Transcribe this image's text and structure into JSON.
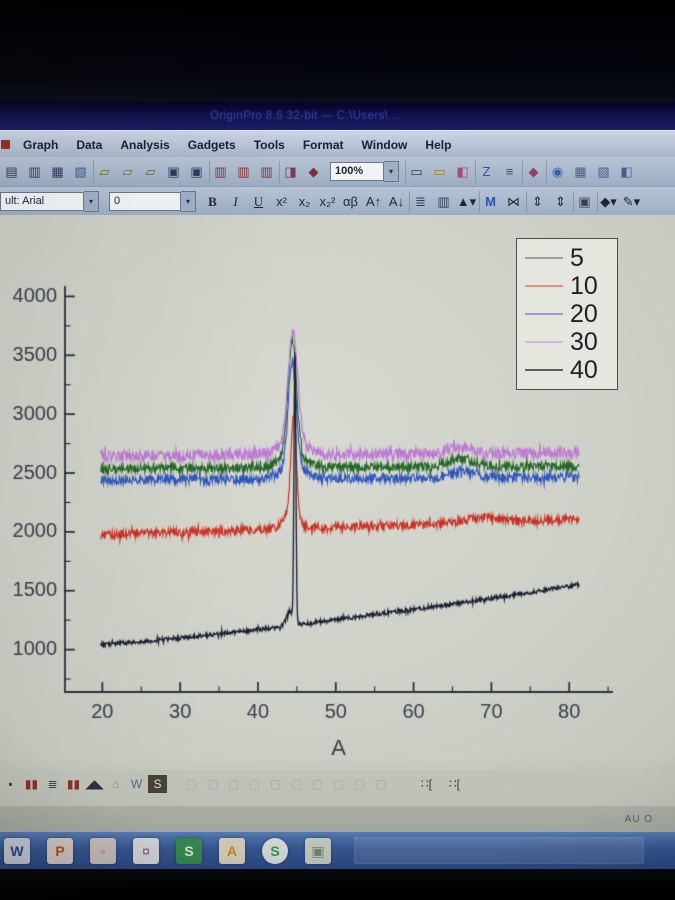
{
  "window": {
    "title": "OriginPro 8.6 32-bit — C:\\Users\\..."
  },
  "menu": {
    "items": [
      {
        "label": "Graph",
        "name": "graph"
      },
      {
        "label": "Data",
        "name": "data"
      },
      {
        "label": "Analysis",
        "name": "analysis"
      },
      {
        "label": "Gadgets",
        "name": "gadgets"
      },
      {
        "label": "Tools",
        "name": "tools"
      },
      {
        "label": "Format",
        "name": "format"
      },
      {
        "label": "Window",
        "name": "window"
      },
      {
        "label": "Help",
        "name": "help"
      }
    ]
  },
  "toolbar_standard": {
    "zoom_value": "100%",
    "left_icons": [
      {
        "glyph": "▤",
        "color": "#2e3a64",
        "name": "new-project"
      },
      {
        "glyph": "▥",
        "color": "#2e3a64",
        "name": "new-workbook"
      },
      {
        "glyph": "▦",
        "color": "#2e3a64",
        "name": "new-graph"
      },
      {
        "glyph": "▧",
        "color": "#3c5e96",
        "name": "new-function"
      },
      {
        "glyph": "▱",
        "color": "#8a6a28",
        "bl": "1px solid #8b99ae",
        "name": "open"
      },
      {
        "glyph": "▱",
        "color": "#8a6a28",
        "name": "open-template"
      },
      {
        "glyph": "▱",
        "color": "#55702e",
        "name": "open-excel"
      },
      {
        "glyph": "▣",
        "color": "#2e3a64",
        "name": "save-project"
      },
      {
        "glyph": "▣",
        "color": "#2e3a64",
        "name": "save-as"
      },
      {
        "glyph": "▥",
        "color": "#93312e",
        "bl": "1px solid #8b99ae",
        "name": "import-wizard"
      },
      {
        "glyph": "▥",
        "color": "#93312e",
        "name": "import-single-ascii"
      },
      {
        "glyph": "▥",
        "color": "#93312e",
        "name": "import-multiple-ascii"
      },
      {
        "glyph": "◨",
        "color": "#7a3a5a",
        "bl": "1px solid #8b99ae",
        "name": "open-theme"
      },
      {
        "glyph": "◆",
        "color": "#8a2a3a",
        "name": "recalculate"
      }
    ],
    "right_icons": [
      {
        "glyph": "▭",
        "color": "#3a3f55",
        "bl": "1px solid #8b99ae",
        "name": "print"
      },
      {
        "glyph": "▭",
        "color": "#a08030",
        "name": "print-preview"
      },
      {
        "glyph": "◧",
        "color": "#b04a7a",
        "name": "copy-format"
      },
      {
        "glyph": "Z",
        "color": "#2255cc",
        "bl": "1px solid #8b99ae",
        "name": "rescale"
      },
      {
        "glyph": "≡",
        "color": "#3a4a6e",
        "name": "layer-arrange"
      },
      {
        "glyph": "◆",
        "color": "#a04060",
        "bl": "1px solid #8b99ae",
        "name": "project-explorer"
      },
      {
        "glyph": "◉",
        "color": "#2a62b8",
        "bl": "1px solid #8b99ae",
        "name": "zoom-tool"
      },
      {
        "glyph": "▦",
        "color": "#46618e",
        "name": "worksheet-view"
      },
      {
        "glyph": "▧",
        "color": "#46618e",
        "name": "format-graph"
      },
      {
        "glyph": "◧",
        "color": "#46618e",
        "name": "clipped-edge"
      }
    ]
  },
  "toolbar_format": {
    "font_value": "ult: Arial",
    "size_value": "0",
    "buttons": [
      {
        "glyph": "B",
        "color": "#1c2640",
        "ff": "Liberation Serif, serif",
        "fw": "700",
        "name": "bold"
      },
      {
        "glyph": "I",
        "color": "#1c2640",
        "ff": "Liberation Serif, serif",
        "fs": "italic",
        "name": "italic"
      },
      {
        "glyph": "U",
        "color": "#1c2640",
        "ff": "Liberation Serif, serif",
        "td": "underline",
        "name": "underline"
      },
      {
        "glyph": "x²",
        "color": "#1c2640",
        "name": "superscript"
      },
      {
        "glyph": "x₂",
        "color": "#1c2640",
        "name": "subscript"
      },
      {
        "glyph": "x₂²",
        "color": "#1c2640",
        "name": "super-subscript"
      },
      {
        "glyph": "αβ",
        "color": "#1c2640",
        "name": "greek"
      },
      {
        "glyph": "A↑",
        "color": "#1c2640",
        "name": "increase-font"
      },
      {
        "glyph": "A↓",
        "color": "#1c2640",
        "name": "decrease-font"
      },
      {
        "glyph": "≣",
        "color": "#2e3a64",
        "bl": "1px solid #8b99ae",
        "name": "line-style"
      },
      {
        "glyph": "▥",
        "color": "#2e3a64",
        "name": "fill-pattern"
      },
      {
        "glyph": "▲▾",
        "color": "#1c2640",
        "name": "symbol-picker"
      },
      {
        "glyph": "M",
        "color": "#2255cc",
        "fw": "700",
        "bl": "1px solid #8b99ae",
        "name": "master-items"
      },
      {
        "glyph": "⋈",
        "color": "#1c2640",
        "name": "mirror"
      },
      {
        "glyph": "⇕",
        "color": "#1c2640",
        "bl": "1px solid #8b99ae",
        "name": "increase-spacing"
      },
      {
        "glyph": "⇕",
        "color": "#1c2640",
        "name": "decrease-spacing"
      },
      {
        "glyph": "▣",
        "color": "#3a3f55",
        "bl": "1px solid #8b99ae",
        "name": "insert-image"
      },
      {
        "glyph": "◆▾",
        "color": "#1c2640",
        "bl": "1px solid #8b99ae",
        "name": "fill-color"
      },
      {
        "glyph": "✎▾",
        "color": "#1c2640",
        "name": "line-color"
      }
    ]
  },
  "toolbar_2d": {
    "icons": [
      {
        "glyph": "▪",
        "color": "#7a3030",
        "name": "clipped-left"
      },
      {
        "glyph": "▮▮",
        "color": "#a03028",
        "name": "column-chart"
      },
      {
        "glyph": "≣",
        "color": "#3a4a6e",
        "name": "line-symbol"
      },
      {
        "glyph": "▮▮",
        "color": "#a03028",
        "name": "bar-chart"
      },
      {
        "glyph": "◢◣",
        "color": "#2a3248",
        "name": "area-chart"
      },
      {
        "glyph": "⌂",
        "color": "#8a8f84",
        "name": "polygon-plot"
      },
      {
        "glyph": "W",
        "color": "#5a6aa0",
        "name": "worksheet"
      },
      {
        "glyph": "S",
        "color": "#efe9d8",
        "bg": "#4c463a",
        "name": "special-plot"
      },
      {
        "glyph": "▢",
        "color": "rgba(80,100,150,0.22)",
        "ml": "14px",
        "name": "ghost-1"
      },
      {
        "glyph": "▢",
        "color": "rgba(80,100,150,0.20)",
        "name": "ghost-2"
      },
      {
        "glyph": "▢",
        "color": "rgba(80,100,150,0.24)",
        "name": "ghost-3"
      },
      {
        "glyph": "▢",
        "color": "rgba(80,100,150,0.20)",
        "name": "ghost-4"
      },
      {
        "glyph": "▢",
        "color": "rgba(80,100,150,0.26)",
        "name": "ghost-5"
      },
      {
        "glyph": "▢",
        "color": "rgba(80,100,150,0.22)",
        "name": "ghost-6"
      },
      {
        "glyph": "▢",
        "color": "rgba(80,100,150,0.25)",
        "name": "ghost-7"
      },
      {
        "glyph": "▢",
        "color": "rgba(80,100,150,0.20)",
        "name": "ghost-8"
      },
      {
        "glyph": "▢",
        "color": "rgba(80,100,150,0.24)",
        "name": "ghost-9"
      },
      {
        "glyph": "▢",
        "color": "rgba(80,100,150,0.21)",
        "name": "ghost-10"
      },
      {
        "glyph": "∷[",
        "color": "#3a3f4a",
        "ml": "26px",
        "name": "edit-handles"
      },
      {
        "glyph": "∷[",
        "color": "#3a3f4a",
        "ml": "8px",
        "name": "edit-handles-2"
      }
    ]
  },
  "status_right": "AU  O",
  "taskbar": {
    "items": [
      {
        "glyph": "W",
        "bg": "#dde3f2",
        "fg": "#2b50a8",
        "fw": "700",
        "name": "word"
      },
      {
        "glyph": "P",
        "bg": "#f0e0d8",
        "fg": "#cc5a1e",
        "fw": "700",
        "name": "powerpoint"
      },
      {
        "glyph": "◦",
        "bg": "#e6d6d2",
        "fg": "#c06060",
        "fw": "400",
        "name": "app-red"
      },
      {
        "glyph": "¤",
        "bg": "#eef0f4",
        "fg": "#b050a0",
        "fw": "400",
        "name": "app-origin"
      },
      {
        "glyph": "S",
        "bg": "#33a053",
        "fg": "#ffffff",
        "fw": "700",
        "name": "app-green-s"
      },
      {
        "glyph": "A",
        "bg": "#f2e8cc",
        "fg": "#dc9c1e",
        "fw": "700",
        "name": "app-a"
      },
      {
        "glyph": "S",
        "bg": "#f4f8f4",
        "fg": "#2eb050",
        "fw": "700",
        "br": "50%",
        "name": "skype"
      },
      {
        "glyph": "▣",
        "bg": "#dce2d8",
        "fg": "#7a9a7a",
        "fw": "400",
        "name": "photos"
      }
    ]
  },
  "chart_data": {
    "type": "line",
    "title": "",
    "xlabel": "A",
    "ylabel": "",
    "xlim": [
      15.2,
      85.5
    ],
    "ylim": [
      640,
      4080
    ],
    "x_ticks": [
      20,
      30,
      40,
      50,
      60,
      70,
      80
    ],
    "y_ticks": [
      1000,
      1500,
      2000,
      2500,
      3000,
      3500,
      4000
    ],
    "x_minor_step": 5,
    "y_minor_step": 250,
    "grid": false,
    "axis_color": "#2c3140",
    "label_color": "#3a3e4e",
    "legend": {
      "position": "top-right",
      "entries": [
        {
          "label": "5",
          "color": "#98a29a"
        },
        {
          "label": "10",
          "color": "#e8948c"
        },
        {
          "label": "20",
          "color": "#8fa2d8"
        },
        {
          "label": "30",
          "color": "#dcb8e6"
        },
        {
          "label": "40",
          "color": "#5c6066"
        }
      ]
    },
    "series": [
      {
        "name": "20",
        "color": "#2a58cc",
        "x_range": [
          19.8,
          81.3
        ],
        "baseline": [
          2440,
          2465
        ],
        "noise": 38,
        "peaks": [
          {
            "center": 44.4,
            "amplitude": 900,
            "width": 0.5
          },
          {
            "center": 44.4,
            "amplitude": 110,
            "width": 1.5
          },
          {
            "center": 66.2,
            "amplitude": 55,
            "width": 1.6
          }
        ]
      },
      {
        "name": "5",
        "color": "#1d6b20",
        "x_range": [
          19.8,
          81.3
        ],
        "baseline": [
          2535,
          2560
        ],
        "noise": 36,
        "peaks": [
          {
            "center": 44.4,
            "amplitude": 960,
            "width": 0.55
          },
          {
            "center": 44.4,
            "amplitude": 120,
            "width": 1.5
          },
          {
            "center": 66.2,
            "amplitude": 65,
            "width": 1.6
          }
        ]
      },
      {
        "name": "30",
        "color": "#c775e2",
        "x_range": [
          19.8,
          81.3
        ],
        "baseline": [
          2645,
          2672
        ],
        "noise": 46,
        "peaks": [
          {
            "center": 44.5,
            "amplitude": 900,
            "width": 0.62
          },
          {
            "center": 44.5,
            "amplitude": 120,
            "width": 1.6
          },
          {
            "center": 66.2,
            "amplitude": 50,
            "width": 1.6
          }
        ]
      },
      {
        "name": "10",
        "color": "#dd2d1e",
        "x_range": [
          19.8,
          81.3
        ],
        "baseline": [
          1975,
          2105
        ],
        "noise": 34,
        "peaks": [
          {
            "center": 44.6,
            "amplitude": 850,
            "width": 0.34
          },
          {
            "center": 44.2,
            "amplitude": 150,
            "width": 0.9
          },
          {
            "center": 69.0,
            "amplitude": 45,
            "width": 2.0
          }
        ]
      },
      {
        "name": "40",
        "color": "#1b2138",
        "x_range": [
          19.8,
          81.3
        ],
        "baseline": [
          1045,
          1550
        ],
        "ramp_exponent": 1.25,
        "noise": 16,
        "peaks": [
          {
            "center": 44.75,
            "amplitude": 2350,
            "width": 0.12
          },
          {
            "center": 44.1,
            "amplitude": 120,
            "width": 0.45
          }
        ]
      }
    ]
  }
}
